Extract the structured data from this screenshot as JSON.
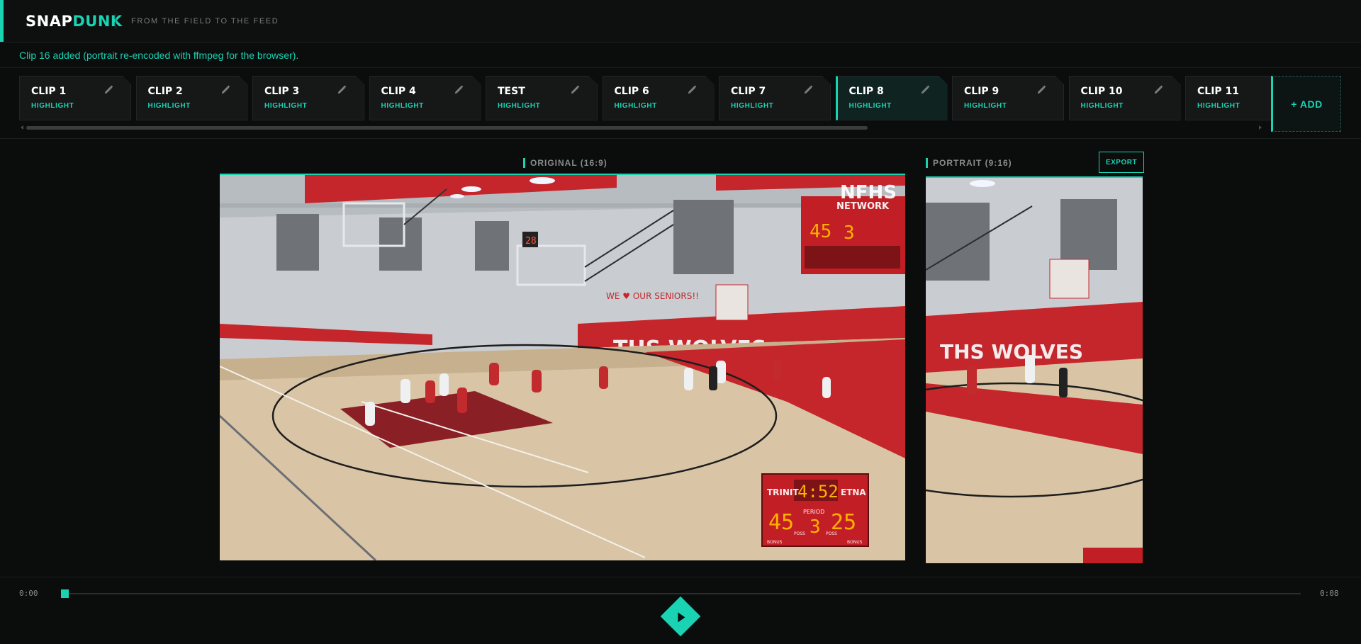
{
  "app": {
    "logo_part1": "SNAP",
    "logo_part2": "DUNK",
    "tagline": "FROM THE FIELD TO THE FEED"
  },
  "status": {
    "message": "Clip 16 added (portrait re-encoded with ffmpeg for the browser)."
  },
  "clips": [
    {
      "title": "CLIP 1",
      "tag": "HIGHLIGHT"
    },
    {
      "title": "CLIP 2",
      "tag": "HIGHLIGHT"
    },
    {
      "title": "CLIP 3",
      "tag": "HIGHLIGHT"
    },
    {
      "title": "CLIP 4",
      "tag": "HIGHLIGHT"
    },
    {
      "title": "TEST",
      "tag": "HIGHLIGHT"
    },
    {
      "title": "CLIP 6",
      "tag": "HIGHLIGHT"
    },
    {
      "title": "CLIP 7",
      "tag": "HIGHLIGHT"
    },
    {
      "title": "CLIP 8",
      "tag": "HIGHLIGHT",
      "active": true
    },
    {
      "title": "CLIP 9",
      "tag": "HIGHLIGHT"
    },
    {
      "title": "CLIP 10",
      "tag": "HIGHLIGHT"
    },
    {
      "title": "CLIP 11",
      "tag": "HIGHLIGHT"
    }
  ],
  "add_label": "+ ADD",
  "original_panel": {
    "label": "ORIGINAL (16:9)"
  },
  "portrait_panel": {
    "label": "PORTRAIT (9:16)",
    "export_label": "EXPORT"
  },
  "video_frame": {
    "watermark_line1": "NFHS",
    "watermark_line2": "NETWORK",
    "banner_text": "THS WOLVES",
    "sign_text": "WE ♥ OUR SENIORS!!",
    "shot_clock": "28",
    "scoreboard": {
      "home_name": "TRINIT",
      "away_name": "ETNA",
      "clock": "4:52",
      "home_score": "45",
      "away_score": "25",
      "period_label": "PERIOD",
      "period": "3",
      "bonus_label": "BONUS",
      "poss_label": "POSS"
    }
  },
  "player": {
    "current_time": "0:00",
    "duration": "0:08",
    "progress": 0
  },
  "icons": {
    "clip_edit": "pencil-icon",
    "play": "play-icon"
  },
  "colors": {
    "accent": "#19d3b3",
    "background": "#0b0c0c",
    "panel": "#161818"
  }
}
